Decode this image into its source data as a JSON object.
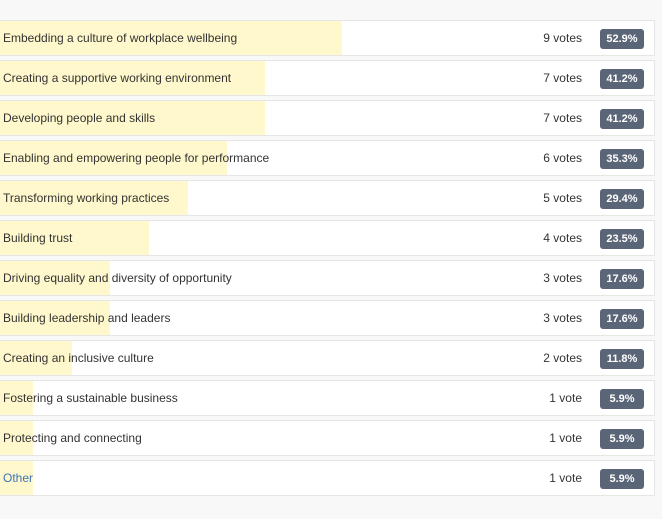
{
  "colors": {
    "fill": "#fff8cc",
    "badge": "#5b6578",
    "link": "#3b73b9"
  },
  "poll": {
    "options": [
      {
        "label": "Embedding a culture of workplace wellbeing",
        "votes": "9 votes",
        "percent": "52.9%",
        "share": 0.523,
        "link": false
      },
      {
        "label": "Creating a supportive working environment",
        "votes": "7 votes",
        "percent": "41.2%",
        "share": 0.405,
        "link": false
      },
      {
        "label": "Developing people and skills",
        "votes": "7 votes",
        "percent": "41.2%",
        "share": 0.405,
        "link": false
      },
      {
        "label": "Enabling and empowering people for performance",
        "votes": "6 votes",
        "percent": "35.3%",
        "share": 0.347,
        "link": false
      },
      {
        "label": "Transforming working practices",
        "votes": "5 votes",
        "percent": "29.4%",
        "share": 0.287,
        "link": false
      },
      {
        "label": "Building trust",
        "votes": "4 votes",
        "percent": "23.5%",
        "share": 0.228,
        "link": false
      },
      {
        "label": "Driving equality and diversity of opportunity",
        "votes": "3 votes",
        "percent": "17.6%",
        "share": 0.168,
        "link": false
      },
      {
        "label": "Building leadership and leaders",
        "votes": "3 votes",
        "percent": "17.6%",
        "share": 0.168,
        "link": false
      },
      {
        "label": "Creating an inclusive culture",
        "votes": "2 votes",
        "percent": "11.8%",
        "share": 0.11,
        "link": false
      },
      {
        "label": "Fostering a sustainable business",
        "votes": "1 vote",
        "percent": "5.9%",
        "share": 0.05,
        "link": false
      },
      {
        "label": "Protecting and connecting",
        "votes": "1 vote",
        "percent": "5.9%",
        "share": 0.05,
        "link": false
      },
      {
        "label": "Other",
        "votes": "1 vote",
        "percent": "5.9%",
        "share": 0.05,
        "link": true
      }
    ]
  }
}
